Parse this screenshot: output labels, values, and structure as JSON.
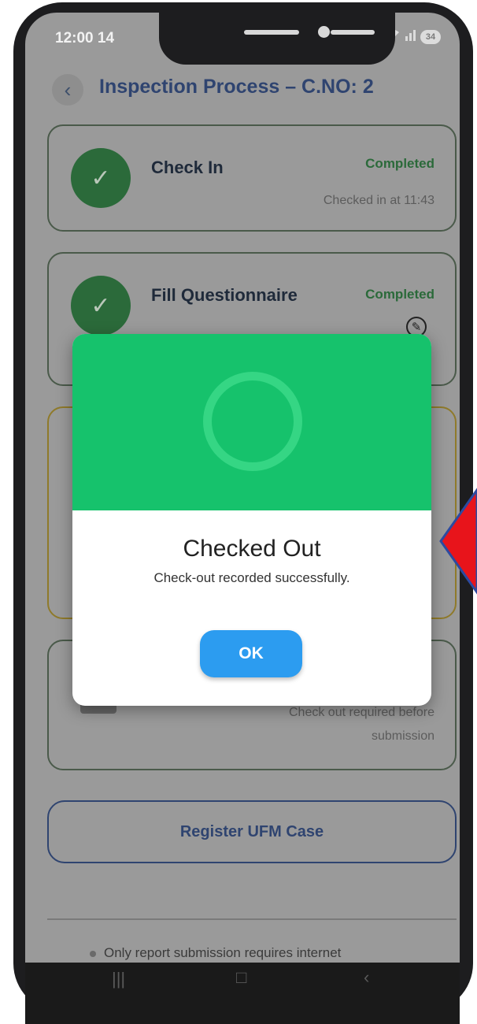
{
  "status_bar": {
    "time": "12:00",
    "extra": "14",
    "signal": "☵ ▐",
    "battery": "34"
  },
  "header": {
    "title": "Inspection Process – C.NO: 2",
    "back_glyph": "‹"
  },
  "steps": [
    {
      "title": "Check In",
      "status": "Completed",
      "detail": "Checked in at 11:43",
      "icon": "check-icon"
    },
    {
      "title": "Fill Questionnaire",
      "status": "Completed",
      "icon": "check-icon",
      "action_icon": "edit-icon"
    }
  ],
  "submit_card": {
    "note_line1": "Check out required before",
    "note_line2": "submission"
  },
  "ufm_button": {
    "label": "Register UFM Case"
  },
  "footer": {
    "note": "Only report submission requires internet"
  },
  "dialog": {
    "title": "Checked Out",
    "message": "Check-out recorded successfully.",
    "ok_label": "OK",
    "header_color": "#16c26c",
    "button_color": "#2c9cf0"
  },
  "annotation": {
    "arrow_color": "#e8141b",
    "arrow_outline": "#2c4aa0"
  }
}
